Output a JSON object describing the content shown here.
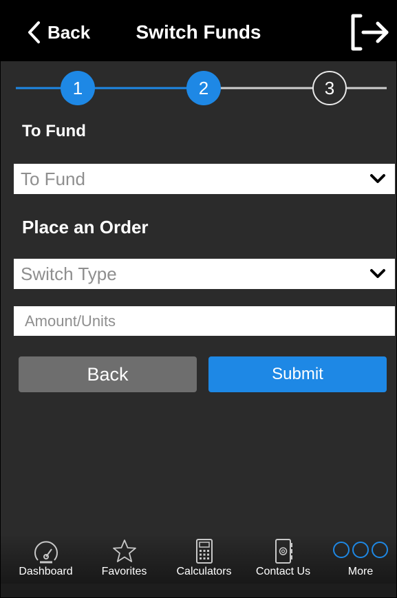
{
  "navbar": {
    "back_label": "Back",
    "title": "Switch Funds"
  },
  "stepper": {
    "steps": [
      "1",
      "2",
      "3"
    ],
    "current_step": 2
  },
  "to_fund": {
    "section_title": "To Fund",
    "select_placeholder": "To Fund"
  },
  "order": {
    "section_title": "Place an Order",
    "switch_type_placeholder": "Switch Type",
    "amount_placeholder": "Amount/Units"
  },
  "actions": {
    "back_label": "Back",
    "submit_label": "Submit"
  },
  "tabbar": {
    "items": [
      {
        "label": "Dashboard",
        "icon": "dashboard-gauge-icon"
      },
      {
        "label": "Favorites",
        "icon": "star-icon"
      },
      {
        "label": "Calculators",
        "icon": "calculator-icon"
      },
      {
        "label": "Contact Us",
        "icon": "contact-book-icon"
      },
      {
        "label": "More",
        "icon": "more-circles-icon"
      }
    ]
  },
  "colors": {
    "accent": "#1e88e5",
    "background": "#2b2b2b",
    "navbar": "#000000",
    "secondary_button": "#6e6e6e"
  }
}
